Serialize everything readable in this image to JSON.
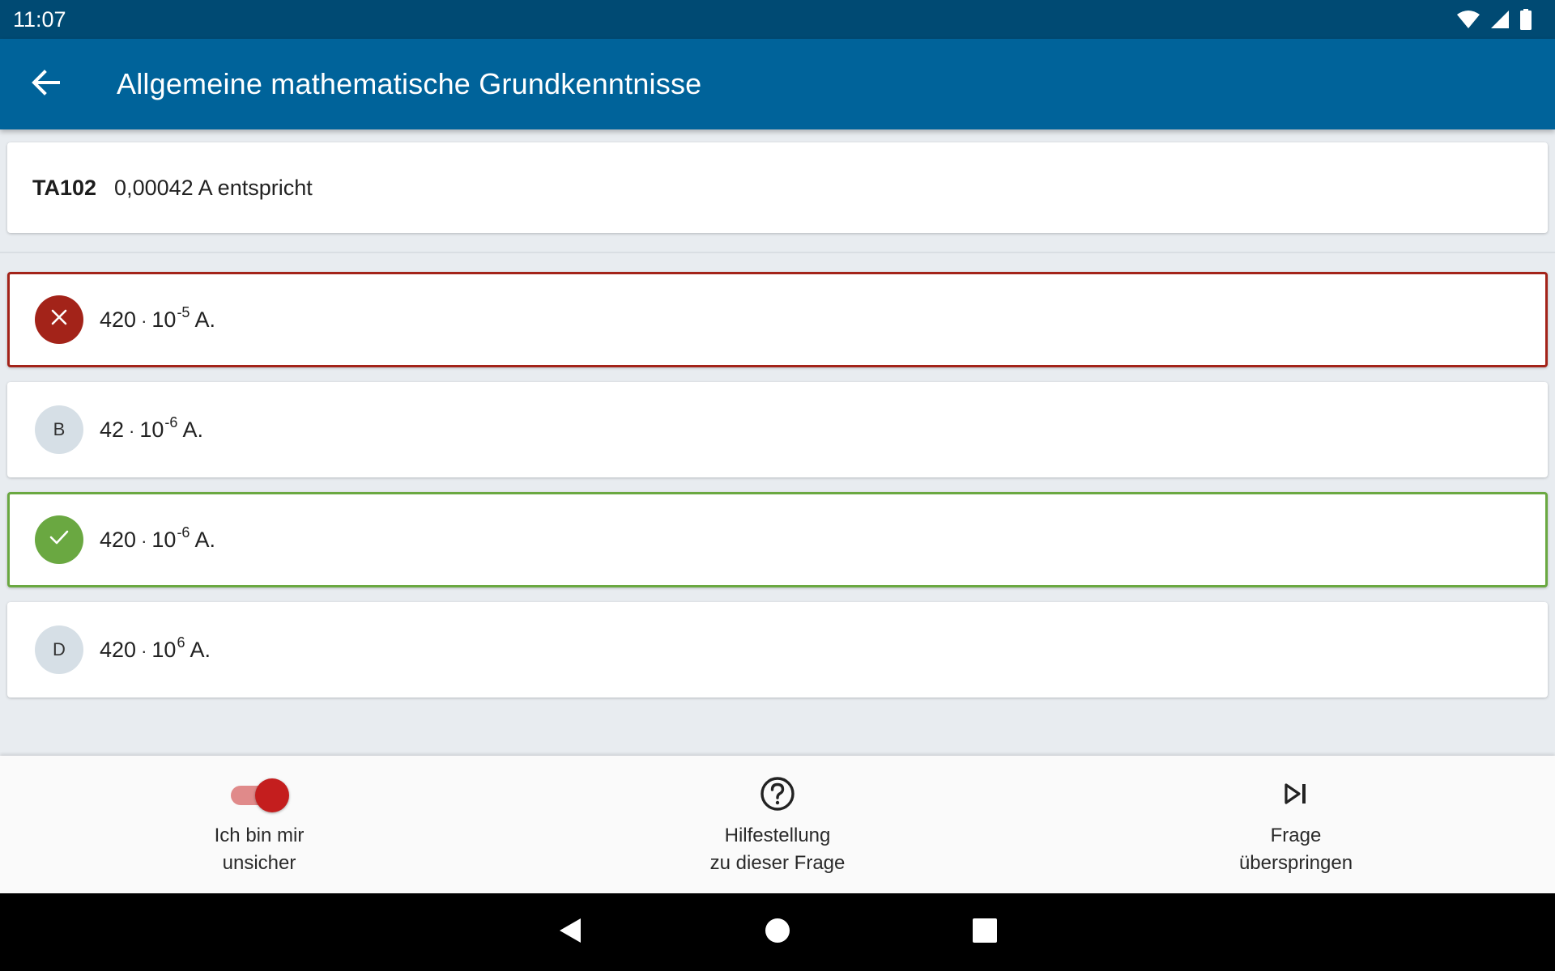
{
  "status_bar": {
    "time": "11:07",
    "icons": [
      "wifi-icon",
      "signal-icon",
      "battery-icon"
    ]
  },
  "app_bar": {
    "title": "Allgemeine mathematische Grundkenntnisse",
    "back_icon": "arrow-back-icon"
  },
  "question": {
    "id": "TA102",
    "text": "0,00042 A entspricht"
  },
  "answers": [
    {
      "marker": "",
      "state": "wrong",
      "marker_icon": "close-icon",
      "mantissa": "420",
      "dot": "·",
      "base": "10",
      "exponent": "-5",
      "unit": "A."
    },
    {
      "marker": "B",
      "state": "neutral",
      "mantissa": "42",
      "dot": "·",
      "base": "10",
      "exponent": "-6",
      "unit": "A."
    },
    {
      "marker": "",
      "state": "correct",
      "marker_icon": "check-icon",
      "mantissa": "420",
      "dot": "·",
      "base": "10",
      "exponent": "-6",
      "unit": "A."
    },
    {
      "marker": "D",
      "state": "neutral",
      "mantissa": "420",
      "dot": "·",
      "base": "10",
      "exponent": "6",
      "unit": "A."
    }
  ],
  "bottom_bar": {
    "unsure": {
      "line1": "Ich bin mir",
      "line2": "unsicher",
      "toggle_on": true
    },
    "help": {
      "line1": "Hilfestellung",
      "line2": "zu dieser Frage",
      "icon": "help-circle-icon"
    },
    "skip": {
      "line1": "Frage",
      "line2": "überspringen",
      "icon": "skip-next-icon"
    }
  },
  "nav_bar": {
    "icons": [
      "nav-back-icon",
      "nav-home-icon",
      "nav-recents-icon"
    ]
  },
  "colors": {
    "status_bar": "#004a73",
    "app_bar": "#00639a",
    "wrong": "#a32319",
    "correct": "#6aa841",
    "toggle_thumb": "#c41e1e",
    "toggle_track": "#e08a8a",
    "background": "#e8ecf0"
  }
}
